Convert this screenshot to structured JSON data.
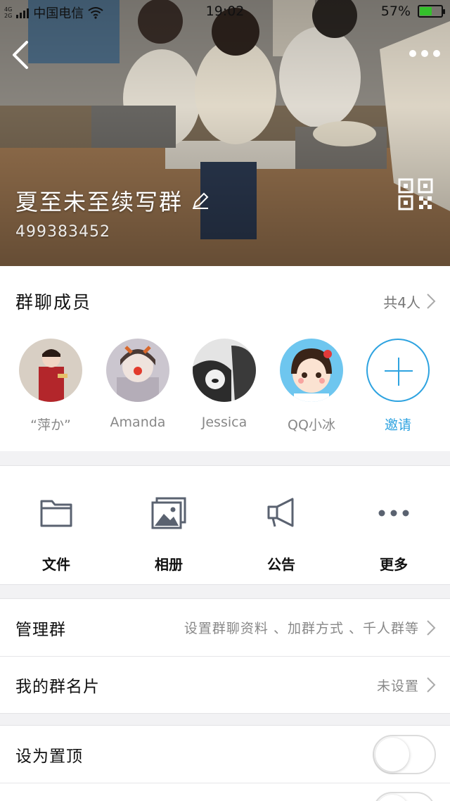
{
  "status_bar": {
    "network": [
      "4G",
      "2G"
    ],
    "carrier": "中国电信",
    "time": "19:02",
    "battery": "57%",
    "battery_level": 0.57
  },
  "header": {
    "group_name": "夏至未至续写群",
    "group_id": "499383452",
    "icons": {
      "back": "back-arrow-icon",
      "more": "more-dots-icon",
      "edit": "pencil-icon",
      "qr": "qr-code-icon"
    }
  },
  "members": {
    "title": "群聊成员",
    "count": "共4人",
    "list": [
      {
        "name": "“萍か”"
      },
      {
        "name": "Amanda"
      },
      {
        "name": "Jessica"
      },
      {
        "name": "QQ小冰"
      }
    ],
    "invite_label": "邀请"
  },
  "actions": [
    {
      "label": "文件",
      "icon": "folder-icon"
    },
    {
      "label": "相册",
      "icon": "album-icon"
    },
    {
      "label": "公告",
      "icon": "megaphone-icon"
    },
    {
      "label": "更多",
      "icon": "more-dots-icon"
    }
  ],
  "settings": {
    "manage_group": {
      "label": "管理群",
      "value": "设置群聊资料 、加群方式 、千人群等"
    },
    "my_card": {
      "label": "我的群名片",
      "value": "未设置"
    },
    "pin_top": {
      "label": "设为置顶",
      "on": false
    }
  },
  "colors": {
    "accent": "#2ea3e0",
    "icon": "#5a6270"
  }
}
